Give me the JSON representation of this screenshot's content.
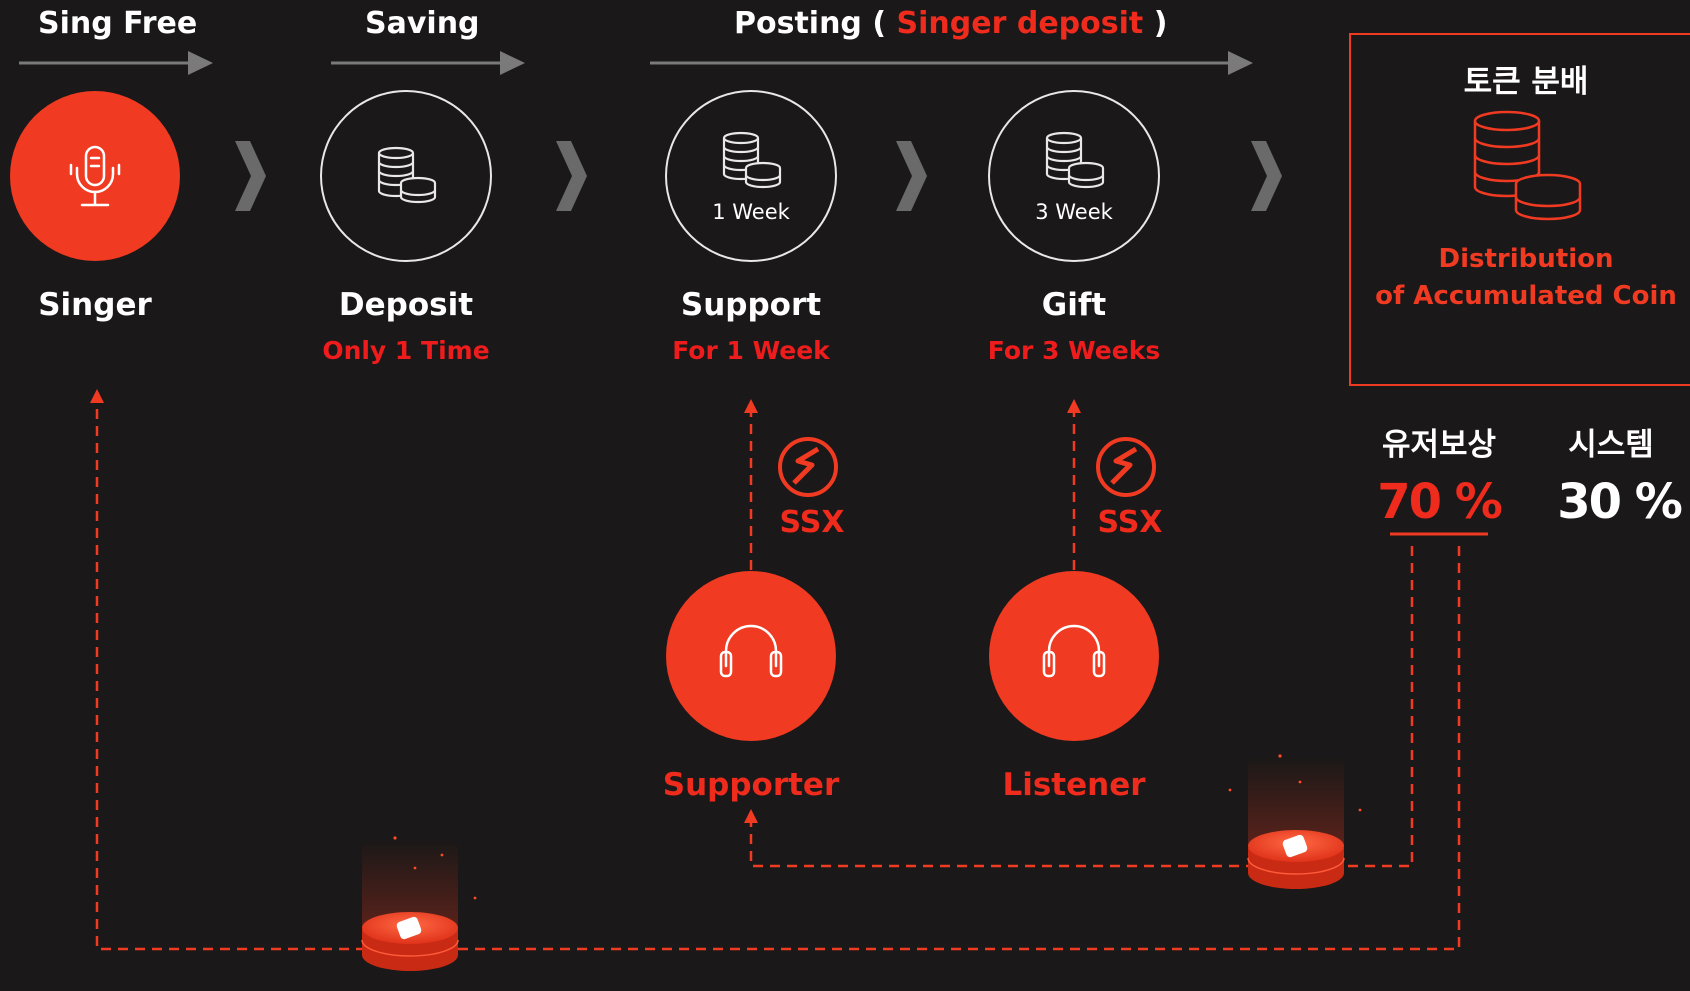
{
  "colors": {
    "accent": "#f03a22",
    "background": "#1a1818",
    "label_red": "#ee1c1c",
    "gray": "#7a7a7a"
  },
  "header": {
    "sing_free": "Sing Free",
    "saving": "Saving",
    "posting": "Posting (",
    "singer_deposit": "Singer deposit",
    "posting_close": ")"
  },
  "nodes": {
    "singer": {
      "label": "Singer",
      "icon": "microphone-icon"
    },
    "deposit": {
      "label": "Deposit",
      "sub": "Only 1 Time",
      "icon": "coins-icon"
    },
    "support": {
      "label": "Support",
      "sub": "For 1 Week",
      "inner": "1 Week",
      "icon": "coins-icon"
    },
    "gift": {
      "label": "Gift",
      "sub": "For 3 Weeks",
      "inner": "3 Week",
      "icon": "coins-icon"
    }
  },
  "distribution": {
    "title": "토큰 분배",
    "line1": "Distribution",
    "line2": "of Accumulated Coin",
    "icon": "coins-stack-icon"
  },
  "split": {
    "user_label": "유저보상",
    "user_pct": "70 %",
    "system_label": "시스템",
    "system_pct": "30 %"
  },
  "tokens": {
    "ssx_1": "SSX",
    "ssx_2": "SSX"
  },
  "roles": {
    "supporter": {
      "label": "Supporter",
      "icon": "headphones-icon"
    },
    "listener": {
      "label": "Listener",
      "icon": "headphones-icon"
    }
  }
}
